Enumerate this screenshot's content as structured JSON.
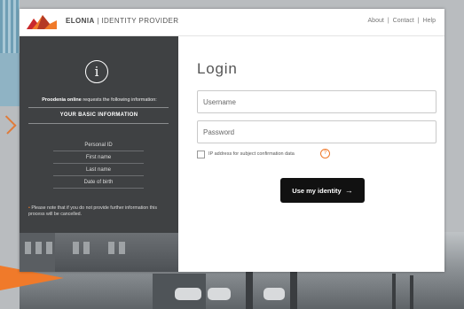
{
  "header": {
    "brand_name": "ELONIA",
    "brand_divider": "|",
    "brand_subtitle": "IDENTITY PROVIDER",
    "nav": [
      "About",
      "|",
      "Contact",
      "|",
      "Help"
    ]
  },
  "panel": {
    "requester": "Proodenia online",
    "requests_text": "requests  the following information:",
    "section_title": "YOUR BASIC INFORMATION",
    "attributes": [
      "Personal ID",
      "First name",
      "Last name",
      "Date of birth"
    ],
    "note": "Please note that if you do not provide further information this process will be cancelled."
  },
  "login": {
    "title": "Login",
    "username_placeholder": "Username",
    "password_placeholder": "Password",
    "ip_label": "IP address for subject confirmation data",
    "help_symbol": "?",
    "submit_label": "Use my identity",
    "submit_arrow": "→"
  },
  "icons": {
    "info": "i",
    "bullet": "•"
  },
  "colors": {
    "accent": "#f07a2a",
    "panel_bg": "#3f4143",
    "button_bg": "#111111"
  }
}
